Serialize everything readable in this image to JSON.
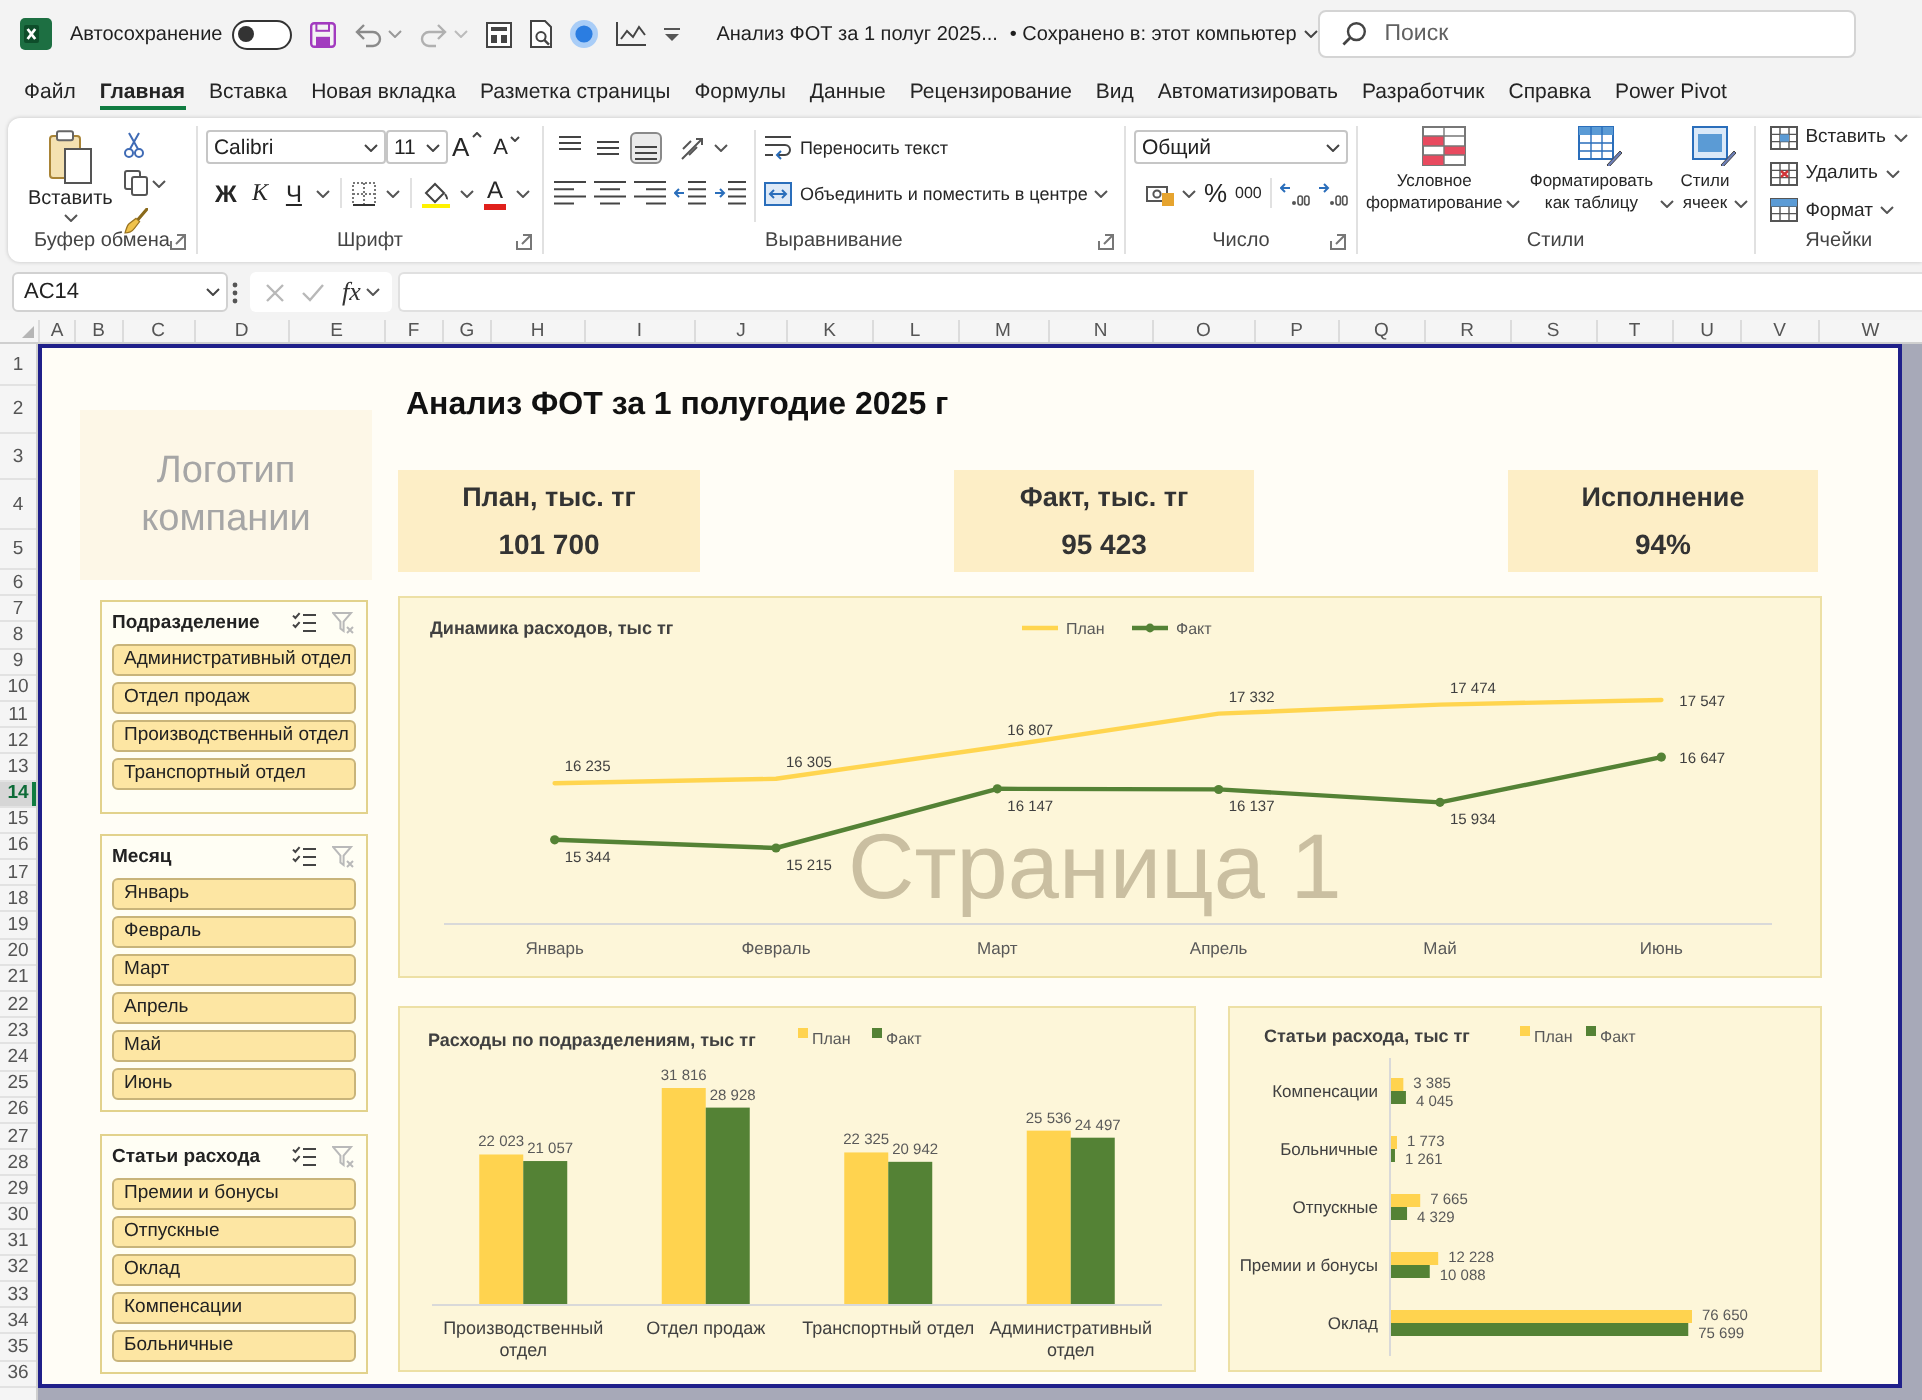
{
  "window": {
    "autosave_label": "Автосохранение",
    "autosave_on": false,
    "title": "Анализ ФОТ за 1 полуг 2025...",
    "save_status": "• Сохранено в: этот компьютер",
    "search": {
      "placeholder": "Поиск"
    }
  },
  "ribbon_tabs": [
    {
      "label": "Файл",
      "selected": false
    },
    {
      "label": "Главная",
      "selected": true
    },
    {
      "label": "Вставка",
      "selected": false
    },
    {
      "label": "Новая вкладка",
      "selected": false
    },
    {
      "label": "Разметка страницы",
      "selected": false
    },
    {
      "label": "Формулы",
      "selected": false
    },
    {
      "label": "Данные",
      "selected": false
    },
    {
      "label": "Рецензирование",
      "selected": false
    },
    {
      "label": "Вид",
      "selected": false
    },
    {
      "label": "Автоматизировать",
      "selected": false
    },
    {
      "label": "Разработчик",
      "selected": false
    },
    {
      "label": "Справка",
      "selected": false
    },
    {
      "label": "Power Pivot",
      "selected": false
    }
  ],
  "ribbon": {
    "clipboard": {
      "label": "Буфер обмена",
      "paste": "Вставить"
    },
    "font": {
      "label": "Шрифт",
      "name": "Calibri",
      "size": "11",
      "grow": "A",
      "shrink": "A",
      "bold": "Ж",
      "italic": "К",
      "underline": "Ч",
      "foreground_button": "A"
    },
    "alignment": {
      "label": "Выравнивание",
      "valign": [
        {
          "kind": "top",
          "selected": false
        },
        {
          "kind": "middle",
          "selected": false
        },
        {
          "kind": "bottom",
          "selected": true
        }
      ],
      "wrap_text": "Переносить текст",
      "merge": "Объединить и поместить в центре"
    },
    "number": {
      "label": "Число",
      "format": "Общий",
      "percent": "%",
      "thousands": "000"
    },
    "styles": {
      "label": "Стили",
      "buttons": [
        {
          "kind": "conditional_formatting",
          "label": "Условное форматирование"
        },
        {
          "kind": "format_as_table",
          "label": "Форматировать как таблицу"
        },
        {
          "kind": "cell_styles",
          "label": "Стили ячеек"
        }
      ]
    },
    "cells": {
      "label": "Ячейки",
      "buttons": [
        {
          "kind": "insert",
          "label": "Вставить"
        },
        {
          "kind": "delete",
          "label": "Удалить"
        },
        {
          "kind": "format",
          "label": "Формат"
        }
      ]
    }
  },
  "formula_bar": {
    "name_box": "AC14",
    "editing": false,
    "function_button": "fx"
  },
  "sheet": {
    "columns": [
      "A",
      "B",
      "C",
      "D",
      "E",
      "F",
      "G",
      "H",
      "I",
      "J",
      "K",
      "L",
      "M",
      "N",
      "O",
      "P",
      "Q",
      "R",
      "S",
      "T",
      "U",
      "V",
      "W"
    ],
    "rows": [
      {
        "label": "1",
        "selected": false
      },
      {
        "label": "2",
        "selected": false
      },
      {
        "label": "3",
        "selected": false
      },
      {
        "label": "4",
        "selected": false
      },
      {
        "label": "5",
        "selected": false
      },
      {
        "label": "6",
        "selected": false
      },
      {
        "label": "7",
        "selected": false
      },
      {
        "label": "8",
        "selected": false
      },
      {
        "label": "9",
        "selected": false
      },
      {
        "label": "10",
        "selected": false
      },
      {
        "label": "11",
        "selected": false
      },
      {
        "label": "12",
        "selected": false
      },
      {
        "label": "13",
        "selected": false
      },
      {
        "label": "14",
        "selected": true
      },
      {
        "label": "15",
        "selected": false
      },
      {
        "label": "16",
        "selected": false
      },
      {
        "label": "17",
        "selected": false
      },
      {
        "label": "18",
        "selected": false
      },
      {
        "label": "19",
        "selected": false
      },
      {
        "label": "20",
        "selected": false
      },
      {
        "label": "21",
        "selected": false
      },
      {
        "label": "22",
        "selected": false
      },
      {
        "label": "23",
        "selected": false
      },
      {
        "label": "24",
        "selected": false
      },
      {
        "label": "25",
        "selected": false
      },
      {
        "label": "26",
        "selected": false
      },
      {
        "label": "27",
        "selected": false
      },
      {
        "label": "28",
        "selected": false
      },
      {
        "label": "29",
        "selected": false
      },
      {
        "label": "30",
        "selected": false
      },
      {
        "label": "31",
        "selected": false
      },
      {
        "label": "32",
        "selected": false
      },
      {
        "label": "33",
        "selected": false
      },
      {
        "label": "34",
        "selected": false
      },
      {
        "label": "35",
        "selected": false
      },
      {
        "label": "36",
        "selected": false
      }
    ]
  },
  "dashboard": {
    "title": "Анализ ФОТ за 1 полугодие 2025 г",
    "logo": "Логотип компании",
    "kpis": [
      {
        "label": "План, тыс. тг",
        "value": "101 700"
      },
      {
        "label": "Факт, тыс. тг",
        "value": "95 423"
      },
      {
        "label": "Исполнение",
        "value": "94%"
      }
    ],
    "slicers": [
      {
        "title": "Подразделение",
        "clear_filter_disabled": true,
        "items": [
          {
            "label": "Административный отдел",
            "selected": true
          },
          {
            "label": "Отдел продаж",
            "selected": true
          },
          {
            "label": "Производственный отдел",
            "selected": true
          },
          {
            "label": "Транспортный отдел",
            "selected": true
          }
        ]
      },
      {
        "title": "Месяц",
        "clear_filter_disabled": true,
        "items": [
          {
            "label": "Январь",
            "selected": true
          },
          {
            "label": "Февраль",
            "selected": true
          },
          {
            "label": "Март",
            "selected": true
          },
          {
            "label": "Апрель",
            "selected": true
          },
          {
            "label": "Май",
            "selected": true
          },
          {
            "label": "Июнь",
            "selected": true
          }
        ]
      },
      {
        "title": "Статьи расхода",
        "clear_filter_disabled": true,
        "items": [
          {
            "label": "Премии и бонусы",
            "selected": true
          },
          {
            "label": "Отпускные",
            "selected": true
          },
          {
            "label": "Оклад",
            "selected": true
          },
          {
            "label": "Компенсации",
            "selected": true
          },
          {
            "label": "Больничные",
            "selected": true
          }
        ]
      }
    ],
    "charts": [
      {
        "chart_data": {
          "type": "line",
          "title": "Динамика расходов, тыс тг",
          "legend": "top",
          "categories": [
            "Январь",
            "Февраль",
            "Март",
            "Апрель",
            "Май",
            "Июнь"
          ],
          "series": [
            {
              "name": "План",
              "color": "#ffd54f",
              "values": [
                16235,
                16305,
                16807,
                17332,
                17474,
                17547
              ]
            },
            {
              "name": "Факт",
              "color": "#548235",
              "marker": "circle",
              "values": [
                15344,
                15215,
                16147,
                16137,
                15934,
                16647
              ]
            }
          ],
          "data_labels": true
        }
      },
      {
        "chart_data": {
          "type": "bar",
          "orientation": "vertical",
          "title": "Расходы по подразделениям, тыс тг",
          "legend": "top",
          "categories": [
            "Производственный отдел",
            "Отдел продаж",
            "Транспортный отдел",
            "Административный отдел"
          ],
          "series": [
            {
              "name": "План",
              "color": "#ffd34f",
              "values": [
                22023,
                31816,
                22325,
                25536
              ]
            },
            {
              "name": "Факт",
              "color": "#548235",
              "values": [
                21057,
                28928,
                20942,
                24497
              ]
            }
          ],
          "data_labels": true
        }
      },
      {
        "chart_data": {
          "type": "bar",
          "orientation": "horizontal",
          "title": "Статьи расхода, тыс тг",
          "legend": "top",
          "categories": [
            "Компенсации",
            "Больничные",
            "Отпускные",
            "Премии и бонусы",
            "Оклад"
          ],
          "series": [
            {
              "name": "Факт",
              "color": "#548235",
              "values": [
                4045,
                1261,
                4329,
                10088,
                75699
              ]
            },
            {
              "name": "План",
              "color": "#ffd34f",
              "values": [
                3385,
                1773,
                7665,
                12228,
                76650
              ]
            }
          ],
          "data_labels": true
        }
      }
    ]
  },
  "page_break_preview": {
    "page_label": "Страница 1"
  }
}
